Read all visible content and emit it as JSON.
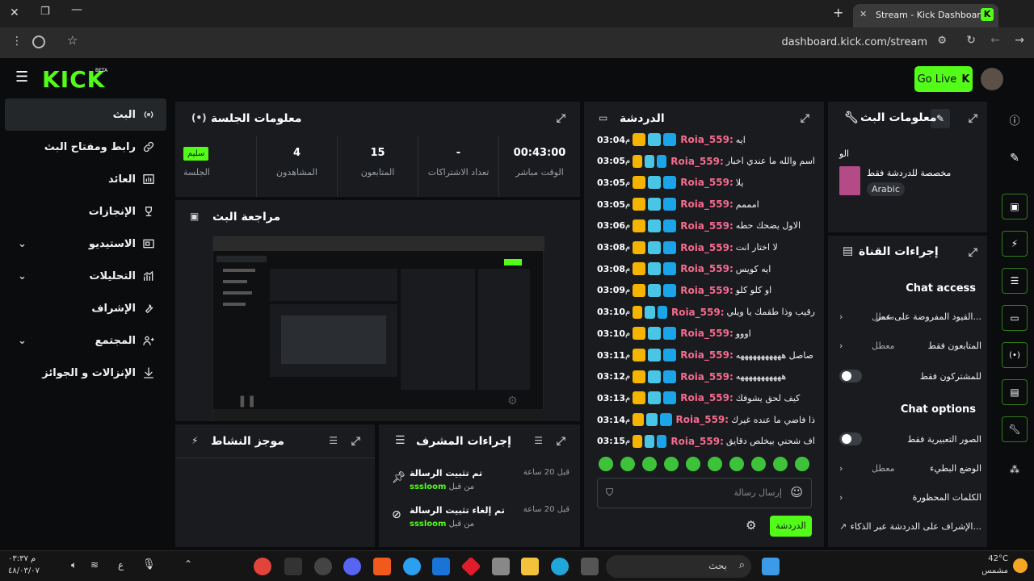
{
  "browser": {
    "tab_title": "Stream - Kick Dashboard",
    "url": "dashboard.kick.com/stream"
  },
  "header": {
    "logo": "KICK",
    "logo_tag": "BETA",
    "go_live": "Go Live"
  },
  "nav": [
    {
      "label": "البث",
      "icon": "broadcast-icon",
      "active": true
    },
    {
      "label": "رابط ومفتاح البث",
      "icon": "link-icon"
    },
    {
      "label": "العائد",
      "icon": "revenue-icon"
    },
    {
      "label": "الإنجازات",
      "icon": "trophy-icon"
    },
    {
      "label": "الاستيديو",
      "icon": "studio-icon",
      "expandable": true
    },
    {
      "label": "التحليلات",
      "icon": "analytics-icon",
      "expandable": true
    },
    {
      "label": "الإشراف",
      "icon": "wrench-icon"
    },
    {
      "label": "المجتمع",
      "icon": "community-icon",
      "expandable": true
    },
    {
      "label": "الإنزالات و الجوائز",
      "icon": "drops-icon"
    }
  ],
  "session": {
    "title": "معلومات الجلسة",
    "stats": [
      {
        "value": "00:43:00",
        "label": "الوقت مباشر"
      },
      {
        "value": "-",
        "label": "تعداد الاشتراكات"
      },
      {
        "value": "15",
        "label": "المتابعون"
      },
      {
        "value": "4",
        "label": "المشاهدون"
      },
      {
        "value": "سليم",
        "label": "الجلسة"
      }
    ]
  },
  "preview": {
    "title": "مراجعة البث"
  },
  "activity": {
    "title": "موجز النشاط"
  },
  "modactions": {
    "title": "إجراءات المشرف",
    "items": [
      {
        "action": "تم تثبيت الرسالة",
        "by_prefix": "من قبل",
        "by": "sssloom",
        "time": "قبل 20 ساعة"
      },
      {
        "action": "تم إلغاء تثبيت الرسالة",
        "by_prefix": "من قبل",
        "by": "sssloom",
        "time": "قبل 20 ساعة"
      }
    ]
  },
  "chat": {
    "title": "الدردشة",
    "input_placeholder": "إرسال رسالة",
    "send_label": "الدردشة",
    "messages": [
      {
        "time": "03:04",
        "ampm": "م",
        "user": "Roia_559:",
        "text": "ايه",
        "badges": 3
      },
      {
        "time": "03:05",
        "ampm": "م",
        "user": "Roia_559:",
        "text": "اسم والله ما عندي اخبار",
        "badges": 3
      },
      {
        "time": "03:05",
        "ampm": "م",
        "user": "Roia_559:",
        "text": "يلا",
        "badges": 3
      },
      {
        "time": "03:05",
        "ampm": "م",
        "user": "Roia_559:",
        "text": "امممم",
        "badges": 3
      },
      {
        "time": "03:06",
        "ampm": "م",
        "user": "Roia_559:",
        "text": "الاول يضحك حطه",
        "badges": 3
      },
      {
        "time": "03:08",
        "ampm": "م",
        "user": "Roia_559:",
        "text": "لا اختار انت",
        "badges": 3
      },
      {
        "time": "03:08",
        "ampm": "م",
        "user": "Roia_559:",
        "text": "ايه كويس",
        "badges": 3
      },
      {
        "time": "03:09",
        "ampm": "م",
        "user": "Roia_559:",
        "text": "او كلو كلو",
        "badges": 3
      },
      {
        "time": "03:10",
        "ampm": "م",
        "user": "Roia_559:",
        "text": "رقيب وذا طقمك يا ويلي",
        "badges": 3
      },
      {
        "time": "03:10",
        "ampm": "م",
        "user": "Roia_559:",
        "text": "اووو",
        "badges": 3
      },
      {
        "time": "03:11",
        "ampm": "م",
        "user": "Roia_559:",
        "text": "صاصل هههههههههههه",
        "badges": 3
      },
      {
        "time": "03:12",
        "ampm": "م",
        "user": "Roia_559:",
        "text": "هههههههههههه",
        "badges": 3
      },
      {
        "time": "03:13",
        "ampm": "م",
        "user": "Roia_559:",
        "text": "كيف لحق يشوفك",
        "badges": 3
      },
      {
        "time": "03:14",
        "ampm": "م",
        "user": "Roia_559:",
        "text": "ذا فاضي ما عنده غيرك",
        "badges": 3
      },
      {
        "time": "03:15",
        "ampm": "م",
        "user": "Roia_559:",
        "text": "اف شحني بيخلص دقايق",
        "badges": 3
      }
    ]
  },
  "streaminfo": {
    "title": "معلومات البث",
    "stream_title": "الو",
    "category": "مخصصة للدردشة فقط",
    "language": "Arabic"
  },
  "channel": {
    "title": "إجراءات القناة",
    "chat_access": "Chat access",
    "chat_options": "Chat options",
    "rows_access": [
      {
        "label": "القيود المفروضة على عمر...",
        "value": "معطل",
        "kind": "chevron"
      },
      {
        "label": "المتابعون فقط",
        "value": "معطل",
        "kind": "chevron"
      },
      {
        "label": "للمشتركون فقط",
        "value": "",
        "kind": "toggle"
      }
    ],
    "rows_options": [
      {
        "label": "الصور التعبيرية فقط",
        "value": "",
        "kind": "toggle"
      },
      {
        "label": "الوضع البطيء",
        "value": "معطل",
        "kind": "chevron"
      },
      {
        "label": "الكلمات المحظورة",
        "value": "",
        "kind": "chevron"
      },
      {
        "label": "الإشراف على الدردشة عبر الذكاء...",
        "value": "",
        "kind": "external"
      }
    ]
  },
  "taskbar": {
    "search": "بحث",
    "temp": "42°C",
    "weather": "مشمس",
    "time": "م ٠٣:٣٧",
    "date": "٤٨/٠٣/٠٧",
    "lang": "ع"
  }
}
